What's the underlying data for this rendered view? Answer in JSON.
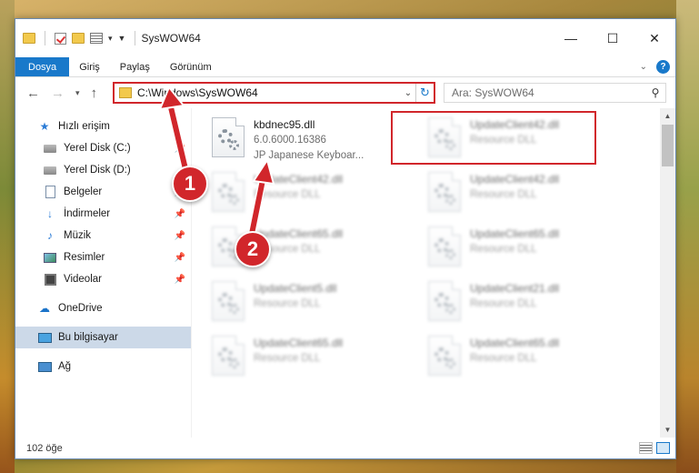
{
  "window": {
    "title": "SysWOW64",
    "controls": {
      "minimize": "—",
      "maximize": "☐",
      "close": "✕"
    }
  },
  "ribbon": {
    "tabs": [
      "Dosya",
      "Giriş",
      "Paylaş",
      "Görünüm"
    ],
    "help": "?",
    "collapse": "⌄"
  },
  "addressbar": {
    "path": "C:\\Windows\\SysWOW64",
    "search_placeholder": "Ara: SysWOW64"
  },
  "navigation": {
    "quick_access": "Hızlı erişim",
    "items": [
      {
        "label": "Yerel Disk (C:)",
        "icon": "disk"
      },
      {
        "label": "Yerel Disk (D:)",
        "icon": "disk"
      },
      {
        "label": "Belgeler",
        "icon": "doc"
      },
      {
        "label": "İndirmeler",
        "icon": "down"
      },
      {
        "label": "Müzik",
        "icon": "music"
      },
      {
        "label": "Resimler",
        "icon": "pic"
      },
      {
        "label": "Videolar",
        "icon": "vid"
      }
    ],
    "onedrive": "OneDrive",
    "this_pc": "Bu bilgisayar",
    "network": "Ağ"
  },
  "files": [
    {
      "name": "kbdnec95.dll",
      "line2": "6.0.6000.16386",
      "line3": "JP Japanese Keyboar...",
      "blurred": false
    },
    {
      "name": "UpdateClient42.dll",
      "line2": "Resource DLL",
      "blurred": true
    },
    {
      "name": "UpdateClient42.dll",
      "line2": "Resource DLL",
      "blurred": true
    },
    {
      "name": "UpdateClient42.dll",
      "line2": "Resource DLL",
      "blurred": true
    },
    {
      "name": "UpdateClient65.dll",
      "line2": "Resource DLL",
      "blurred": true
    },
    {
      "name": "UpdateClient65.dll",
      "line2": "Resource DLL",
      "blurred": true
    },
    {
      "name": "UpdateClient5.dll",
      "line2": "Resource DLL",
      "blurred": true
    },
    {
      "name": "UpdateClient21.dll",
      "line2": "Resource DLL",
      "blurred": true
    },
    {
      "name": "UpdateClient65.dll",
      "line2": "Resource DLL",
      "blurred": true
    },
    {
      "name": "UpdateClient65.dll",
      "line2": "Resource DLL",
      "blurred": true
    }
  ],
  "status": {
    "count": "102 öğe"
  },
  "annotations": {
    "step1": "1",
    "step2": "2",
    "color": "#d1262b"
  }
}
